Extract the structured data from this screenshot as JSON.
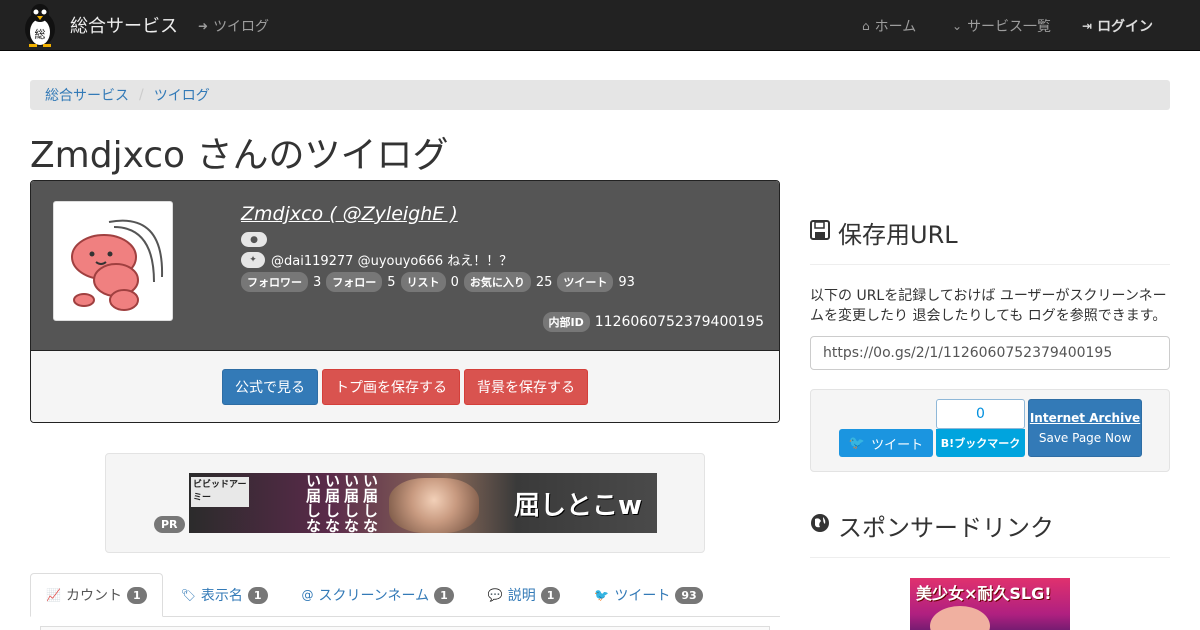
{
  "navbar": {
    "brand": "総合サービス",
    "logo_glyph": "総",
    "twilog": "ツイログ",
    "home": "ホーム",
    "services": "サービス一覧",
    "login": "ログイン"
  },
  "breadcrumb": [
    "総合サービス",
    "ツイログ"
  ],
  "page_title": "Zmdjxco さんのツイログ",
  "profile": {
    "name": "Zmdjxco ( @ZyleighE )",
    "bio": "@dai119277 @uyouyo666 ねえ！！？",
    "stats": [
      {
        "label": "フォロワー",
        "value": "3"
      },
      {
        "label": "フォロー",
        "value": "5"
      },
      {
        "label": "リスト",
        "value": "0"
      },
      {
        "label": "お気に入り",
        "value": "25"
      },
      {
        "label": "ツイート",
        "value": "93"
      }
    ],
    "internal_id_label": "内部ID",
    "internal_id": "1126060752379400195",
    "buttons": {
      "official": "公式で見る",
      "save_avatar": "トプ画を保存する",
      "save_bg": "背景を保存する"
    }
  },
  "ad": {
    "pr": "PR",
    "banner_brand": "ビビッドアーミー",
    "banner_vertical": "い届しない届しない届しない届しな",
    "banner_main": "屈しとこw"
  },
  "tabs": [
    {
      "label": "カウント",
      "count": "1",
      "icon": "line-chart-icon",
      "glyph": "📈"
    },
    {
      "label": "表示名",
      "count": "1",
      "icon": "tag-icon",
      "glyph": "🏷"
    },
    {
      "label": "スクリーンネーム",
      "count": "1",
      "icon": "at-icon",
      "glyph": "@"
    },
    {
      "label": "説明",
      "count": "1",
      "icon": "comment-icon",
      "glyph": "💬"
    },
    {
      "label": "ツイート",
      "count": "93",
      "icon": "twitter-icon",
      "glyph": "🐦"
    }
  ],
  "save_section": {
    "title": "保存用URL",
    "description": "以下の URLを記録しておけば ユーザーがスクリーンネームを変更したり 退会したりしても ログを参照できます。",
    "url": "https://0o.gs/2/1/1126060752379400195",
    "tweet": "ツイート",
    "hatena_count": "0",
    "hatena": "B!ブックマーク",
    "ia_line1": "Internet Archive",
    "ia_line2": "Save Page Now"
  },
  "sponsor": {
    "title": "スポンサードリンク",
    "ad_text": "美少女×耐久SLG!"
  },
  "colors": {
    "navbar": "#222222",
    "primary": "#337ab7",
    "danger": "#d9534f",
    "profile_bg": "#555555",
    "badge": "#777777"
  }
}
